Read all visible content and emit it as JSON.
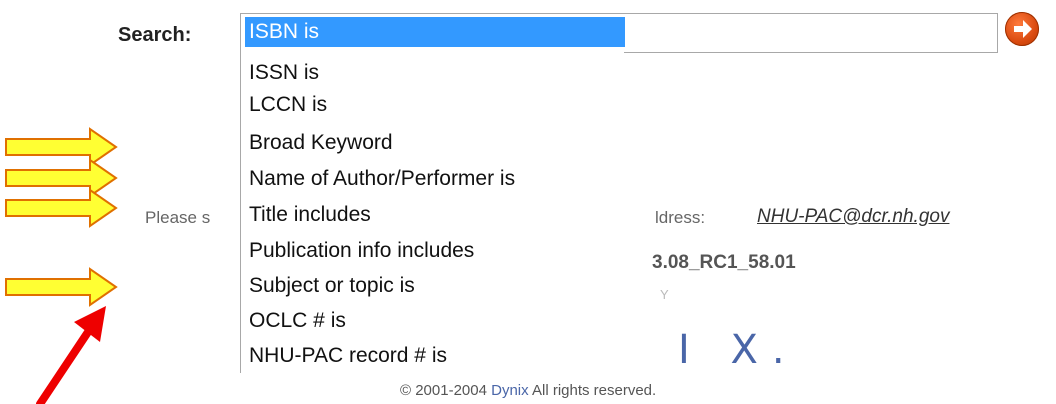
{
  "search": {
    "label": "Search:",
    "options": [
      "ISBN is",
      "ISSN is",
      "LCCN is",
      "Broad Keyword",
      "Name of Author/Performer is",
      "Title includes",
      "Publication info includes",
      "Subject or topic is",
      "OCLC # is",
      "NHU-PAC record # is"
    ]
  },
  "footer": {
    "please_text": "Please s",
    "address_label": "ldress:",
    "email": "NHU-PAC@dcr.nh.gov",
    "version": "3.08_RC1_58.01",
    "partial_y": "Y",
    "logo_fragment": "I X.",
    "copyright_prefix": "© 2001-2004",
    "copyright_link": "Dynix",
    "copyright_suffix": "All rights reserved."
  },
  "colors": {
    "selected_option_bg": "#3399ff",
    "annotation_arrow_fill": "#ffff33",
    "annotation_arrow_stroke": "#e07000",
    "annotation_pointer": "#ee0000",
    "go_button": "#d94a10",
    "logo": "#4a66a8"
  }
}
